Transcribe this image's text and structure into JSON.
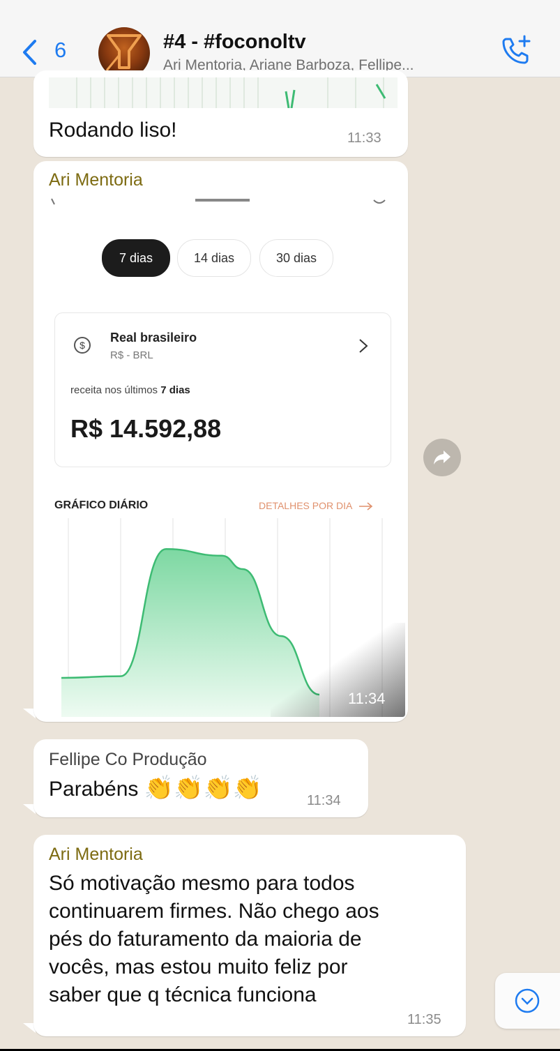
{
  "header": {
    "back_count": "6",
    "title": "#4 - #foconoltv",
    "subtitle": "Ari Mentoria, Ariane Barboza, Fellipe..."
  },
  "messages": [
    {
      "text": "Rodando liso!",
      "time": "11:33"
    },
    {
      "sender": "Ari Mentoria",
      "time": "11:34",
      "image": {
        "period_tabs": [
          "7 dias",
          "14 dias",
          "30 dias"
        ],
        "active_tab": "7 dias",
        "currency_name": "Real brasileiro",
        "currency_code": "R$ - BRL",
        "revenue_label_prefix": "receita nos últimos ",
        "revenue_label_days": "7 dias",
        "revenue_value": "R$ 14.592,88",
        "graph_title": "GRÁFICO DIÁRIO",
        "graph_link": "DETALHES POR DIA",
        "chart_data": {
          "type": "area",
          "values": [
            0.15,
            0.16,
            0.92,
            0.88,
            0.8,
            0.4,
            0.05
          ],
          "color": "#3dbb73"
        }
      }
    },
    {
      "sender": "Fellipe Co Produção",
      "text": "Parabéns",
      "emoji": [
        "👏",
        "👏",
        "👏",
        "👏"
      ],
      "time": "11:34"
    },
    {
      "sender": "Ari Mentoria",
      "lines": [
        "Só motivação mesmo para todos",
        "continuarem firmes. Não chego aos",
        "pés do faturamento da maioria de",
        "vocês, mas estou muito feliz por",
        "saber que q técnica funciona"
      ],
      "time": "11:35"
    }
  ],
  "colors": {
    "accent_blue": "#1e7bf0",
    "sender_olive": "#7d6b12",
    "chat_background": "#ebe4da"
  }
}
